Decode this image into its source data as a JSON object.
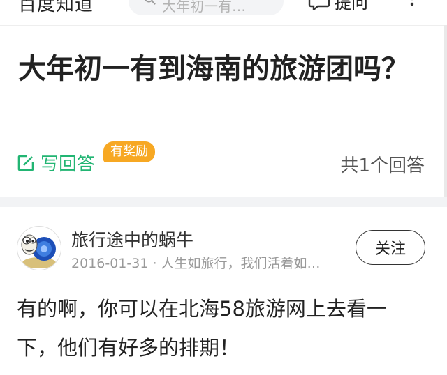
{
  "topbar": {
    "logo_text": "百度知道",
    "search_placeholder": "大年初一有…",
    "ask_label": "提问"
  },
  "question": {
    "title": "大年初一有到海南的旅游团吗？",
    "write_answer_label": "写回答",
    "reward_badge": "有奖励",
    "answer_count": "共1个回答"
  },
  "answer": {
    "user_name": "旅行途中的蜗牛",
    "meta": "2016-01-31 · 人生如旅行，我们活着如…",
    "follow_label": "关注",
    "body": "有的啊，你可以在北海58旅游网上去看一下，他们有好多的排期！"
  },
  "colors": {
    "accent_green": "#22b573",
    "reward_orange": "#f7a823"
  },
  "icons": {
    "search": "search-icon",
    "ask": "ask-icon",
    "more": "more-icon",
    "edit": "edit-icon",
    "avatar": "snail-avatar"
  }
}
